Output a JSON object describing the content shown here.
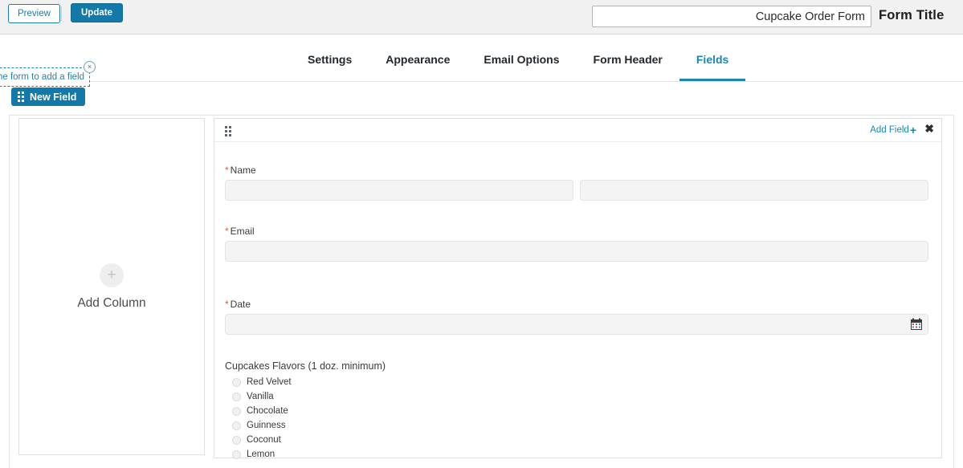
{
  "toolbar": {
    "preview_label": "Preview",
    "update_label": "Update",
    "form_title_value": "Cupcake Order Form",
    "form_title_placeholder": "Form Title",
    "form_title_label": "Form Title"
  },
  "tabs": [
    {
      "label": "Settings",
      "active": false
    },
    {
      "label": "Appearance",
      "active": false
    },
    {
      "label": "Email Options",
      "active": false
    },
    {
      "label": "Form Header",
      "active": false
    },
    {
      "label": "Fields",
      "active": true
    }
  ],
  "drag_tip": {
    "text": "he form to add a field",
    "close_label": "×"
  },
  "new_field_button": {
    "label": "New Field"
  },
  "column_placeholder": {
    "plus": "+",
    "label": "Add Column"
  },
  "field_panel": {
    "add_field_label": "Add Field",
    "add_field_plus": "+",
    "close_label": "✖",
    "fields": [
      {
        "label": "Name",
        "required_marker": "*",
        "type": "name-split"
      },
      {
        "label": "Email",
        "required_marker": "*",
        "type": "text"
      },
      {
        "label": "Date",
        "required_marker": "*",
        "type": "date"
      }
    ],
    "choice_field": {
      "title": "Cupcakes Flavors (1 doz. minimum)",
      "options": [
        "Red Velvet",
        "Vanilla",
        "Chocolate",
        "Guinness",
        "Coconut",
        "Lemon"
      ]
    }
  },
  "colors": {
    "accent": "#1b87b0",
    "button": "#1279a8",
    "required": "#d3603a",
    "topbar_bg": "#f1f1f1"
  }
}
